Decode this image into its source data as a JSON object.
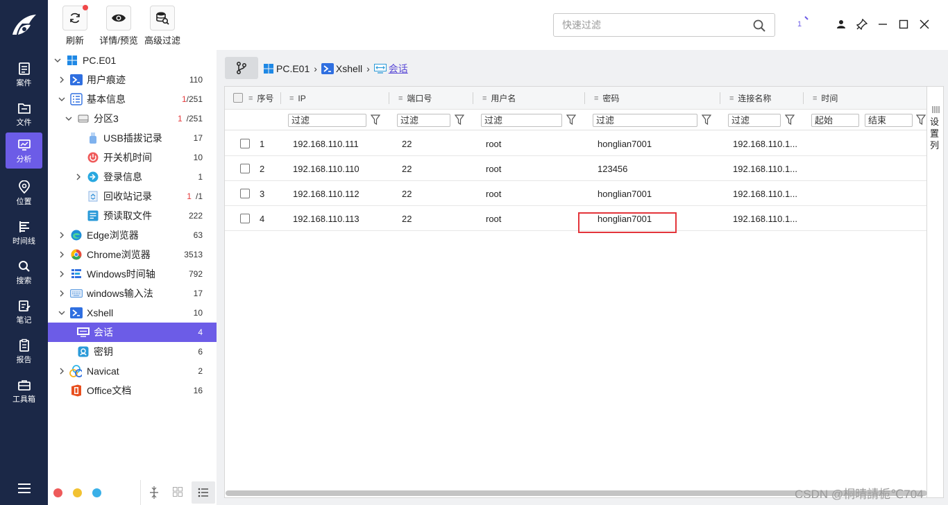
{
  "toolbar": {
    "refresh_label": "刷新",
    "preview_label": "详情/预览",
    "advfilter_label": "高级过滤",
    "search_placeholder": "快速过滤",
    "notify_count": "1"
  },
  "nav": {
    "items": [
      {
        "label": "案件"
      },
      {
        "label": "文件"
      },
      {
        "label": "分析"
      },
      {
        "label": "位置"
      },
      {
        "label": "时间线"
      },
      {
        "label": "搜索"
      },
      {
        "label": "笔记"
      },
      {
        "label": "报告"
      },
      {
        "label": "工具箱"
      }
    ],
    "active_index": 2
  },
  "tree": {
    "root": "PC.E01",
    "items": [
      {
        "label": "用户痕迹",
        "count": "110",
        "icon": "xshell-like-icon"
      },
      {
        "label": "基本信息",
        "count_red": "1",
        "count": "/251",
        "icon": "list-icon"
      },
      {
        "label": "分区3",
        "count_red": "1",
        "count": "/251",
        "icon": "drive-icon"
      },
      {
        "label": "USB插拔记录",
        "count": "17",
        "icon": "usb-icon"
      },
      {
        "label": "开关机时间",
        "count": "10",
        "icon": "power-icon"
      },
      {
        "label": "登录信息",
        "count": "1",
        "icon": "login-icon"
      },
      {
        "label": "回收站记录",
        "count_red": "1",
        "count": "/1",
        "icon": "recycle-icon"
      },
      {
        "label": "预读取文件",
        "count": "222",
        "icon": "prefetch-icon"
      },
      {
        "label": "Edge浏览器",
        "count": "63",
        "icon": "edge-icon"
      },
      {
        "label": "Chrome浏览器",
        "count": "3513",
        "icon": "chrome-icon"
      },
      {
        "label": "Windows时间轴",
        "count": "792",
        "icon": "timeline-icon"
      },
      {
        "label": "windows输入法",
        "count": "17",
        "icon": "keyboard-icon"
      },
      {
        "label": "Xshell",
        "count": "10",
        "icon": "xshell-icon"
      },
      {
        "label": "会话",
        "count": "4",
        "icon": "session-icon"
      },
      {
        "label": "密钥",
        "count": "6",
        "icon": "key-icon"
      },
      {
        "label": "Navicat",
        "count": "2",
        "icon": "navicat-icon"
      },
      {
        "label": "Office文档",
        "count": "16",
        "icon": "office-icon"
      }
    ]
  },
  "breadcrumb": {
    "root": "PC.E01",
    "parent": "Xshell",
    "current": "会话"
  },
  "grid": {
    "columns": [
      "序号",
      "IP",
      "端口号",
      "用户名",
      "密码",
      "连接名称",
      "时间"
    ],
    "filter_placeholder": "过滤",
    "time_start": "起始",
    "time_end": "结束",
    "rows": [
      {
        "no": "1",
        "ip": "192.168.110.111",
        "port": "22",
        "user": "root",
        "password": "honglian7001",
        "name": "192.168.110.1..."
      },
      {
        "no": "2",
        "ip": "192.168.110.110",
        "port": "22",
        "user": "root",
        "password": "123456",
        "name": "192.168.110.1..."
      },
      {
        "no": "3",
        "ip": "192.168.110.112",
        "port": "22",
        "user": "root",
        "password": "honglian7001",
        "name": "192.168.110.1..."
      },
      {
        "no": "4",
        "ip": "192.168.110.113",
        "port": "22",
        "user": "root",
        "password": "honglian7001",
        "name": "192.168.110.1..."
      }
    ],
    "settings_label": "设置列"
  },
  "watermark": "CSDN @桐晴請栀℃704",
  "colors": {
    "nav_bg": "#1b2847",
    "accent": "#6c5ce7",
    "highlight_box": "#e3343a"
  }
}
